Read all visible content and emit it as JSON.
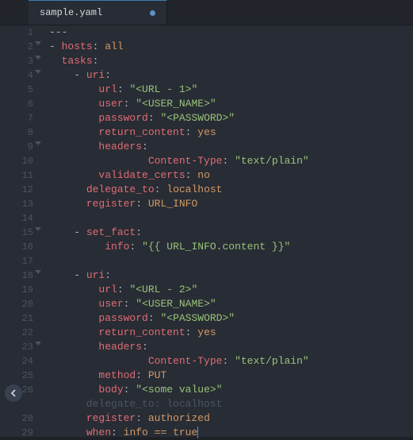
{
  "tab": {
    "filename": "sample.yaml"
  },
  "lines": [
    {
      "num": "1",
      "fold": false,
      "tokens": [
        [
          "c-punc",
          "---"
        ]
      ]
    },
    {
      "num": "2",
      "fold": true,
      "tokens": [
        [
          "c-punc",
          "- "
        ],
        [
          "c-key",
          "hosts"
        ],
        [
          "c-punc",
          ":"
        ],
        [
          "c-punc",
          " "
        ],
        [
          "c-val",
          "all"
        ]
      ]
    },
    {
      "num": "3",
      "fold": true,
      "tokens": [
        [
          "c-punc",
          "  "
        ],
        [
          "c-key",
          "tasks"
        ],
        [
          "c-punc",
          ":"
        ]
      ]
    },
    {
      "num": "4",
      "fold": true,
      "tokens": [
        [
          "c-punc",
          "    - "
        ],
        [
          "c-key",
          "uri"
        ],
        [
          "c-punc",
          ":"
        ]
      ]
    },
    {
      "num": "5",
      "fold": false,
      "tokens": [
        [
          "c-punc",
          "        "
        ],
        [
          "c-key",
          "url"
        ],
        [
          "c-punc",
          ":"
        ],
        [
          "c-punc",
          " "
        ],
        [
          "c-str",
          "\"<URL - 1>\""
        ]
      ]
    },
    {
      "num": "6",
      "fold": false,
      "tokens": [
        [
          "c-punc",
          "        "
        ],
        [
          "c-key",
          "user"
        ],
        [
          "c-punc",
          ":"
        ],
        [
          "c-punc",
          " "
        ],
        [
          "c-str",
          "\"<USER_NAME>\""
        ]
      ]
    },
    {
      "num": "7",
      "fold": false,
      "tokens": [
        [
          "c-punc",
          "        "
        ],
        [
          "c-key",
          "password"
        ],
        [
          "c-punc",
          ":"
        ],
        [
          "c-punc",
          " "
        ],
        [
          "c-str",
          "\"<PASSWORD>\""
        ]
      ]
    },
    {
      "num": "8",
      "fold": false,
      "tokens": [
        [
          "c-punc",
          "        "
        ],
        [
          "c-key",
          "return_content"
        ],
        [
          "c-punc",
          ":"
        ],
        [
          "c-punc",
          " "
        ],
        [
          "c-val",
          "yes"
        ]
      ]
    },
    {
      "num": "9",
      "fold": true,
      "tokens": [
        [
          "c-punc",
          "        "
        ],
        [
          "c-key",
          "headers"
        ],
        [
          "c-punc",
          ":"
        ]
      ]
    },
    {
      "num": "10",
      "fold": false,
      "tokens": [
        [
          "c-punc",
          "                "
        ],
        [
          "c-key",
          "Content-Type"
        ],
        [
          "c-punc",
          ":"
        ],
        [
          "c-punc",
          " "
        ],
        [
          "c-str",
          "\"text/plain\""
        ]
      ]
    },
    {
      "num": "11",
      "fold": false,
      "tokens": [
        [
          "c-punc",
          "        "
        ],
        [
          "c-key",
          "validate_certs"
        ],
        [
          "c-punc",
          ":"
        ],
        [
          "c-punc",
          " "
        ],
        [
          "c-val",
          "no"
        ]
      ]
    },
    {
      "num": "12",
      "fold": false,
      "tokens": [
        [
          "c-punc",
          "      "
        ],
        [
          "c-key",
          "delegate_to"
        ],
        [
          "c-punc",
          ":"
        ],
        [
          "c-punc",
          " "
        ],
        [
          "c-val",
          "localhost"
        ]
      ]
    },
    {
      "num": "13",
      "fold": false,
      "tokens": [
        [
          "c-punc",
          "      "
        ],
        [
          "c-key",
          "register"
        ],
        [
          "c-punc",
          ":"
        ],
        [
          "c-punc",
          " "
        ],
        [
          "c-val",
          "URL_INFO"
        ]
      ]
    },
    {
      "num": "14",
      "fold": false,
      "tokens": []
    },
    {
      "num": "15",
      "fold": true,
      "tokens": [
        [
          "c-punc",
          "    - "
        ],
        [
          "c-key",
          "set_fact"
        ],
        [
          "c-punc",
          ":"
        ]
      ]
    },
    {
      "num": "16",
      "fold": false,
      "tokens": [
        [
          "c-punc",
          "         "
        ],
        [
          "c-key",
          "info"
        ],
        [
          "c-punc",
          ":"
        ],
        [
          "c-punc",
          " "
        ],
        [
          "c-str",
          "\"{{ URL_INFO.content }}\""
        ]
      ]
    },
    {
      "num": "17",
      "fold": false,
      "tokens": []
    },
    {
      "num": "18",
      "fold": true,
      "tokens": [
        [
          "c-punc",
          "    - "
        ],
        [
          "c-key",
          "uri"
        ],
        [
          "c-punc",
          ":"
        ]
      ]
    },
    {
      "num": "19",
      "fold": false,
      "tokens": [
        [
          "c-punc",
          "        "
        ],
        [
          "c-key",
          "url"
        ],
        [
          "c-punc",
          ":"
        ],
        [
          "c-punc",
          " "
        ],
        [
          "c-str",
          "\"<URL - 2>\""
        ]
      ]
    },
    {
      "num": "20",
      "fold": false,
      "tokens": [
        [
          "c-punc",
          "        "
        ],
        [
          "c-key",
          "user"
        ],
        [
          "c-punc",
          ":"
        ],
        [
          "c-punc",
          " "
        ],
        [
          "c-str",
          "\"<USER_NAME>\""
        ]
      ]
    },
    {
      "num": "21",
      "fold": false,
      "tokens": [
        [
          "c-punc",
          "        "
        ],
        [
          "c-key",
          "password"
        ],
        [
          "c-punc",
          ":"
        ],
        [
          "c-punc",
          " "
        ],
        [
          "c-str",
          "\"<PASSWORD>\""
        ]
      ]
    },
    {
      "num": "22",
      "fold": false,
      "tokens": [
        [
          "c-punc",
          "        "
        ],
        [
          "c-key",
          "return_content"
        ],
        [
          "c-punc",
          ":"
        ],
        [
          "c-punc",
          " "
        ],
        [
          "c-val",
          "yes"
        ]
      ]
    },
    {
      "num": "23",
      "fold": true,
      "tokens": [
        [
          "c-punc",
          "        "
        ],
        [
          "c-key",
          "headers"
        ],
        [
          "c-punc",
          ":"
        ]
      ]
    },
    {
      "num": "24",
      "fold": false,
      "tokens": [
        [
          "c-punc",
          "                "
        ],
        [
          "c-key",
          "Content-Type"
        ],
        [
          "c-punc",
          ":"
        ],
        [
          "c-punc",
          " "
        ],
        [
          "c-str",
          "\"text/plain\""
        ]
      ]
    },
    {
      "num": "25",
      "fold": false,
      "tokens": [
        [
          "c-punc",
          "        "
        ],
        [
          "c-key",
          "method"
        ],
        [
          "c-punc",
          ":"
        ],
        [
          "c-punc",
          " "
        ],
        [
          "c-val",
          "PUT"
        ]
      ]
    },
    {
      "num": "26",
      "fold": false,
      "tokens": [
        [
          "c-punc",
          "        "
        ],
        [
          "c-key",
          "body"
        ],
        [
          "c-punc",
          ":"
        ],
        [
          "c-punc",
          " "
        ],
        [
          "c-str",
          "\"<some value>\""
        ]
      ]
    },
    {
      "num": "28",
      "fold": false,
      "tokens": [
        [
          "c-punc",
          "      "
        ],
        [
          "c-key",
          "register"
        ],
        [
          "c-punc",
          ":"
        ],
        [
          "c-punc",
          " "
        ],
        [
          "c-val",
          "authorized"
        ]
      ]
    },
    {
      "num": "29",
      "fold": false,
      "tokens": [
        [
          "c-punc",
          "      "
        ],
        [
          "c-key",
          "when"
        ],
        [
          "c-punc",
          ":"
        ],
        [
          "c-punc",
          " "
        ],
        [
          "c-val",
          "info == true"
        ]
      ],
      "cursor": true
    }
  ],
  "hidden_after_26": "      delegate_to: localhost"
}
